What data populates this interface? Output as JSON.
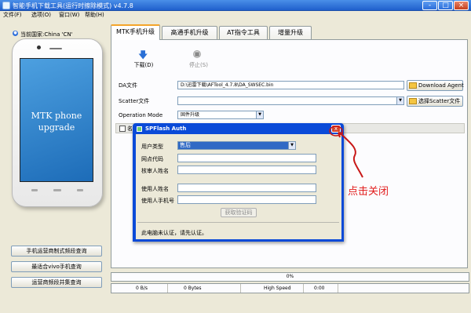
{
  "window": {
    "title": "智能手机下载工具(运行时擦除模式)  v4.7.8",
    "min_label": "-",
    "max_label": "□",
    "close_label": "×"
  },
  "menu": {
    "items": [
      {
        "label": "文件(F)"
      },
      {
        "label": "选项(O)"
      },
      {
        "label": "窗口(W)"
      },
      {
        "label": "帮助(H)"
      }
    ]
  },
  "sidebar": {
    "country_label": "当前国家:China 'CN'",
    "phone_text_line1": "MTK phone",
    "phone_text_line2": "upgrade",
    "buttons": [
      {
        "label": "手机运营商制式频段查询"
      },
      {
        "label": "最适合vivo手机查询"
      },
      {
        "label": "运营商频段并集查询"
      }
    ]
  },
  "tabs": [
    {
      "label": "MTK手机升级",
      "active": true
    },
    {
      "label": "高通手机升级",
      "active": false
    },
    {
      "label": "AT指令工具",
      "active": false
    },
    {
      "label": "增量升级",
      "active": false
    }
  ],
  "toolbar": {
    "download_label": "下载(D)",
    "stop_label": "停止(S)",
    "download_icon": "download-arrow-icon",
    "stop_icon": "stop-icon"
  },
  "form": {
    "da_label": "DA文件",
    "da_value": "D:\\迅雷下载\\AFTool_4.7.8\\DA_SWSEC.bin",
    "download_agent_btn": "Download Agent",
    "scatter_label": "Scatter文件",
    "scatter_value": "",
    "scatter_btn": "选择Scatter文件",
    "op_mode_label": "Operation Mode",
    "op_mode_value": "固件升级"
  },
  "list": {
    "header_label": "名"
  },
  "dialog": {
    "title": "SPFlash Auth",
    "user_type_label": "用户类型",
    "user_type_value": "售后",
    "branch_code_label": "网点代码",
    "reviewer_label": "核审人姓名",
    "user_name_label": "使用人姓名",
    "user_phone_label": "使用人手机号",
    "get_code_btn": "获取验证码",
    "status_text": "此电脑未认证，请先认证。",
    "close_label": "x"
  },
  "annotation": {
    "text": "点击关闭",
    "color": "#e21c1c"
  },
  "progress": {
    "text": "0%",
    "value": 0
  },
  "status": {
    "bytes_per_sec": "0 B/s",
    "bytes": "0 Bytes",
    "speed": "High Speed",
    "time": "0:00"
  },
  "colors": {
    "titlebar": "#2d6edb",
    "dialog_frame": "#0a4ad8",
    "tab_accent": "#f4a52a",
    "window_bg": "#ece9d8"
  }
}
